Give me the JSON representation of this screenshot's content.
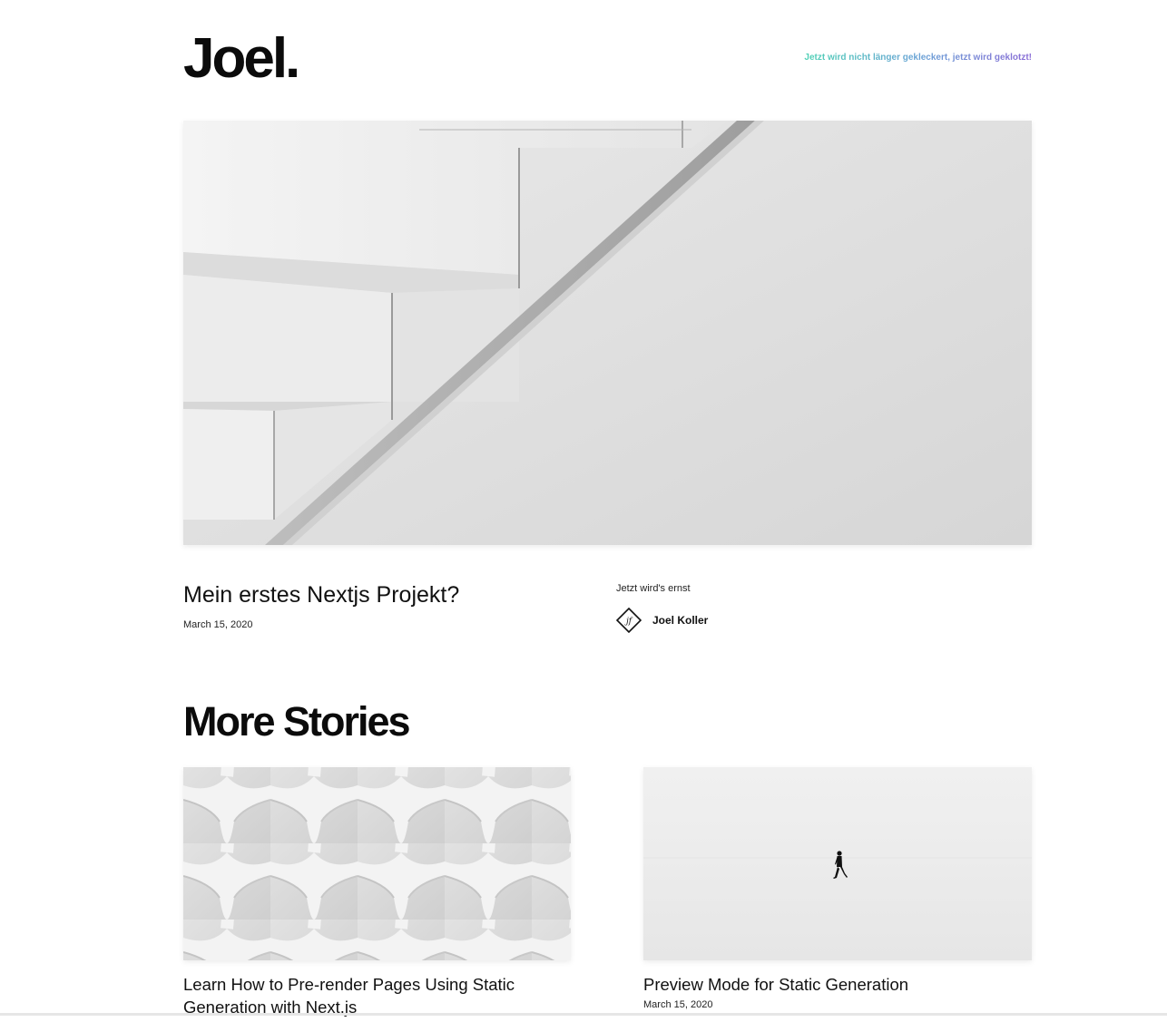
{
  "header": {
    "logo": "Joel.",
    "tagline": "Jetzt wird nicht länger gekleckert, jetzt wird geklotzt!"
  },
  "hero": {
    "image_icon": "architecture-photo",
    "title": "Mein erstes Nextjs Projekt?",
    "date": "March 15, 2020",
    "excerpt": "Jetzt wird's ernst",
    "author": {
      "name": "Joel Koller",
      "avatar_text": "jf"
    }
  },
  "more_stories": {
    "heading": "More Stories",
    "stories": [
      {
        "title": "Learn How to Pre-render Pages Using Static Generation with Next.js",
        "date": "",
        "image_icon": "lattice-photo"
      },
      {
        "title": "Preview Mode for Static Generation",
        "date": "March 15, 2020",
        "image_icon": "snow-walker-photo"
      }
    ]
  },
  "colors": {
    "tagline_gradient_start": "#4fd1b5",
    "tagline_gradient_end": "#8a6cd6"
  }
}
